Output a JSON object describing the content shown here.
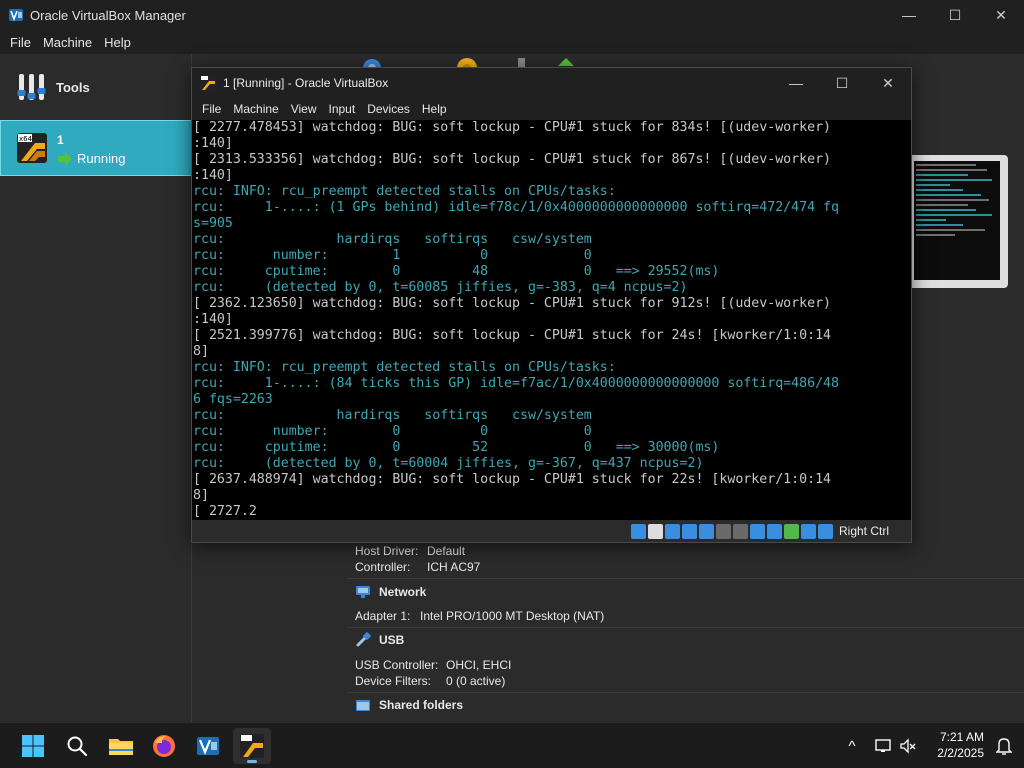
{
  "manager": {
    "title": "Oracle VirtualBox Manager",
    "window_controls": {
      "minimize": "—",
      "maximize": "☐",
      "close": "✕"
    },
    "menu": [
      "File",
      "Machine",
      "Help"
    ],
    "sidebar": {
      "tools_label": "Tools",
      "vm": {
        "name": "1",
        "state": "Running"
      }
    },
    "details": {
      "audio": {
        "host_driver_key": "Host Driver:",
        "host_driver_val": "Default",
        "controller_key": "Controller:",
        "controller_val": "ICH AC97"
      },
      "network": {
        "title": "Network",
        "adapter_key": "Adapter 1:",
        "adapter_val": "Intel PRO/1000 MT Desktop (NAT)"
      },
      "usb": {
        "title": "USB",
        "controller_key": "USB Controller:",
        "controller_val": "OHCI, EHCI",
        "filters_key": "Device Filters:",
        "filters_val": "0 (0 active)"
      },
      "shared": {
        "title": "Shared folders"
      }
    }
  },
  "vmwindow": {
    "title": "1 [Running] - Oracle VirtualBox",
    "window_controls": {
      "minimize": "—",
      "maximize": "☐",
      "close": "✕"
    },
    "menu": [
      "File",
      "Machine",
      "View",
      "Input",
      "Devices",
      "Help"
    ],
    "console_lines": [
      {
        "t": "[ 2277.478453] watchdog: BUG: soft lockup - CPU#1 stuck for 834s! [(udev-worker)",
        "c": false
      },
      {
        "t": ":140]",
        "c": false
      },
      {
        "t": "[ 2313.533356] watchdog: BUG: soft lockup - CPU#1 stuck for 867s! [(udev-worker)",
        "c": false
      },
      {
        "t": ":140]",
        "c": false
      },
      {
        "t": "rcu: INFO: rcu_preempt detected stalls on CPUs/tasks:",
        "c": true
      },
      {
        "t": "rcu:     1-....: (1 GPs behind) idle=f78c/1/0x4000000000000000 softirq=472/474 fq",
        "c": true
      },
      {
        "t": "s=905",
        "c": true
      },
      {
        "t": "rcu:              hardirqs   softirqs   csw/system",
        "c": true
      },
      {
        "t": "rcu:      number:        1          0            0",
        "c": true
      },
      {
        "t": "rcu:     cputime:        0         48            0   ==> 29552(ms)",
        "c": true
      },
      {
        "t": "rcu:     (detected by 0, t=60085 jiffies, g=-383, q=4 ncpus=2)",
        "c": true
      },
      {
        "t": "[ 2362.123650] watchdog: BUG: soft lockup - CPU#1 stuck for 912s! [(udev-worker)",
        "c": false
      },
      {
        "t": ":140]",
        "c": false
      },
      {
        "t": "[ 2521.399776] watchdog: BUG: soft lockup - CPU#1 stuck for 24s! [kworker/1:0:14",
        "c": false
      },
      {
        "t": "8]",
        "c": false
      },
      {
        "t": "rcu: INFO: rcu_preempt detected stalls on CPUs/tasks:",
        "c": true
      },
      {
        "t": "rcu:     1-....: (84 ticks this GP) idle=f7ac/1/0x4000000000000000 softirq=486/48",
        "c": true
      },
      {
        "t": "6 fqs=2263",
        "c": true
      },
      {
        "t": "rcu:              hardirqs   softirqs   csw/system",
        "c": true
      },
      {
        "t": "rcu:      number:        0          0            0",
        "c": true
      },
      {
        "t": "rcu:     cputime:        0         52            0   ==> 30000(ms)",
        "c": true
      },
      {
        "t": "rcu:     (detected by 0, t=60004 jiffies, g=-367, q=437 ncpus=2)",
        "c": true
      },
      {
        "t": "[ 2637.488974] watchdog: BUG: soft lockup - CPU#1 stuck for 22s! [kworker/1:0:14",
        "c": false
      },
      {
        "t": "8]",
        "c": false
      },
      {
        "t": "[ 2727.2",
        "c": false
      }
    ],
    "statusbar": {
      "host_key": "Right Ctrl"
    }
  },
  "taskbar": {
    "time": "7:21 AM",
    "date": "2/2/2025",
    "tray_chevron": "^"
  },
  "colors": {
    "accent_selection": "#2faabf",
    "console_cyan": "#3da6b1",
    "console_gray": "#c7c7c7"
  }
}
